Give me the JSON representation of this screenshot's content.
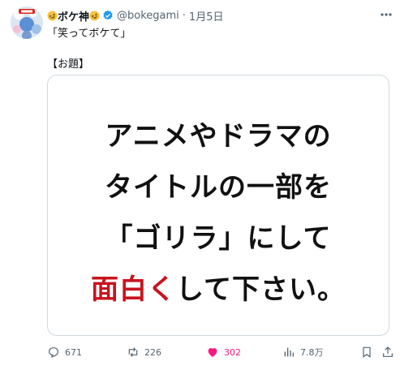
{
  "tweet": {
    "display_name": "ボケ神",
    "handle": "@bokegami",
    "separator": "·",
    "date": "1月5日",
    "text": "「笑ってボケて」\n\n【お題】"
  },
  "media": {
    "lines": [
      {
        "parts": [
          {
            "text": "アニメやドラマの",
            "highlight": false
          }
        ]
      },
      {
        "parts": [
          {
            "text": "タイトルの一部を",
            "highlight": false
          }
        ]
      },
      {
        "parts": [
          {
            "text": "「ゴリラ」にして",
            "highlight": false
          }
        ]
      },
      {
        "parts": [
          {
            "text": "面白く",
            "highlight": true
          },
          {
            "text": "して下さい。",
            "highlight": false
          }
        ]
      }
    ],
    "highlight_color": "#c8141e"
  },
  "actions": {
    "replies": "671",
    "reposts": "226",
    "likes": "302",
    "views": "7.8万"
  },
  "icons": {
    "avatar": "avatar",
    "emoji": "rolling-on-floor-laughing-emoji",
    "verified": "verified-badge-icon",
    "more": "more-icon",
    "reply": "reply-icon",
    "repost": "repost-icon",
    "like": "heart-icon",
    "views": "views-icon",
    "bookmark": "bookmark-icon",
    "share": "share-icon"
  },
  "colors": {
    "like": "#f91880",
    "verified": "#1d9bf0",
    "muted": "#536471"
  }
}
